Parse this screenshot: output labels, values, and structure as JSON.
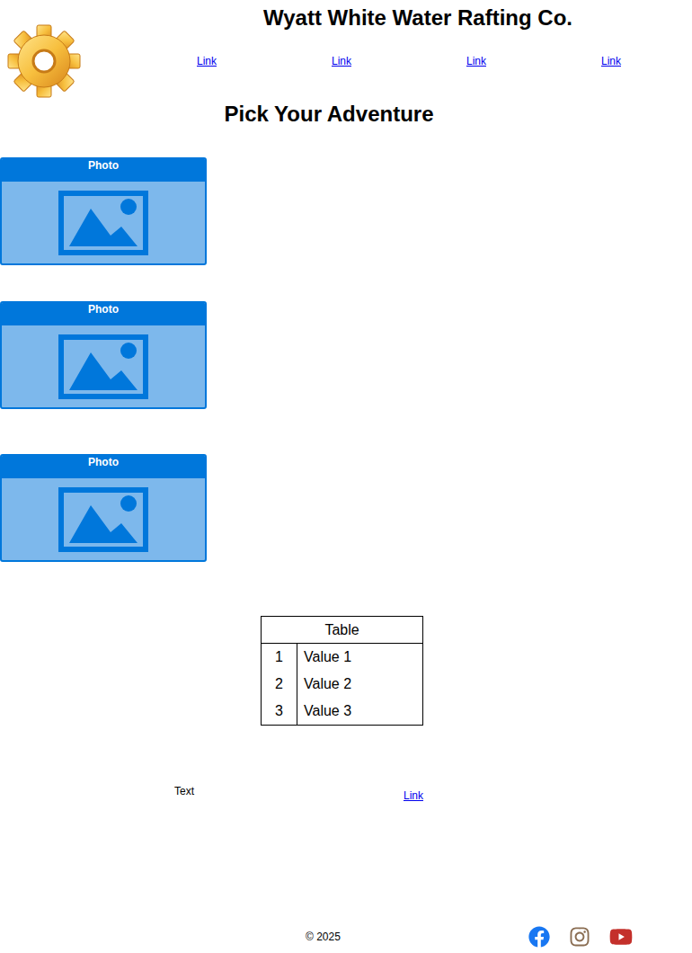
{
  "header": {
    "title": "Wyatt White Water Rafting Co.",
    "nav": [
      "Link",
      "Link",
      "Link",
      "Link"
    ]
  },
  "heading": "Pick Your Adventure",
  "photos": [
    {
      "label": "Photo"
    },
    {
      "label": "Photo"
    },
    {
      "label": "Photo"
    }
  ],
  "table": {
    "title": "Table",
    "rows": [
      {
        "index": "1",
        "value": "Value 1"
      },
      {
        "index": "2",
        "value": "Value 2"
      },
      {
        "index": "3",
        "value": "Value 3"
      }
    ]
  },
  "info": {
    "text": "Text",
    "link": "Link"
  },
  "footer": {
    "copyright": "© 2025"
  }
}
